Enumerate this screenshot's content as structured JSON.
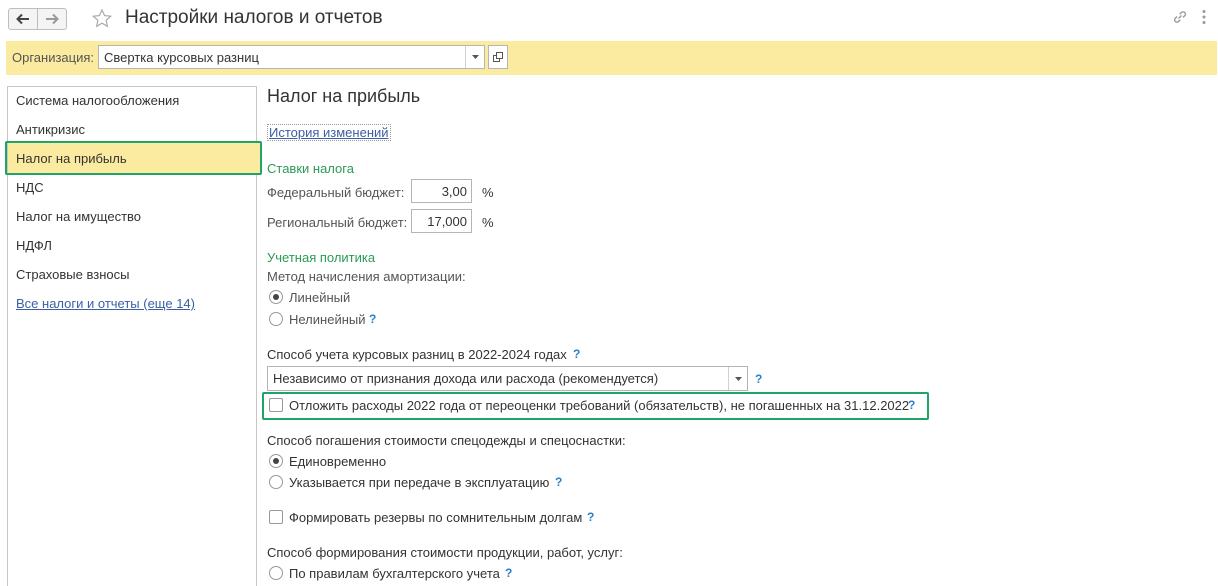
{
  "window": {
    "title": "Настройки налогов и отчетов"
  },
  "org": {
    "label": "Организация:",
    "value": "Свертка курсовых разниц"
  },
  "nav": {
    "items": [
      {
        "label": "Система налогообложения"
      },
      {
        "label": "Антикризис"
      },
      {
        "label": "Налог на прибыль"
      },
      {
        "label": "НДС"
      },
      {
        "label": "Налог на имущество"
      },
      {
        "label": "НДФЛ"
      },
      {
        "label": "Страховые взносы"
      }
    ],
    "more_link": "Все налоги и отчеты (еще 14)",
    "active_index": 2
  },
  "content": {
    "title": "Налог на прибыль",
    "history_link": "История изменений",
    "rates": {
      "heading": "Ставки налога",
      "federal_label": "Федеральный бюджет:",
      "federal_value": "3,00",
      "regional_label": "Региональный бюджет:",
      "regional_value": "17,000",
      "unit": "%"
    },
    "policy": {
      "heading": "Учетная политика",
      "amortization_label": "Метод начисления амортизации:",
      "amort_linear": "Линейный",
      "amort_nonlinear": "Нелинейный",
      "amort_selected": "Линейный",
      "fx_label": "Способ учета курсовых разниц в 2022-2024 годах",
      "fx_value": "Независимо от признания дохода или расхода (рекомендуется)",
      "defer_label": "Отложить расходы 2022 года от переоценки требований (обязательств), не погашенных на 31.12.2022",
      "defer_checked": false,
      "workwear_label": "Способ погашения стоимости спецодежды и спецоснастки:",
      "workwear_once": "Единовременно",
      "workwear_transfer": "Указывается при передаче в эксплуатацию",
      "workwear_selected": "Единовременно",
      "reserves_label": "Формировать резервы по сомнительным долгам",
      "reserves_checked": false,
      "cost_label": "Способ формирования стоимости продукции, работ, услуг:",
      "cost_option": "По правилам бухгалтерского учета",
      "help_mark": "?"
    }
  },
  "colors": {
    "accent_yellow": "#fbeba0",
    "highlight_green": "#21a366",
    "link_blue": "#3b5fa5",
    "group_green": "#2b9a55"
  }
}
